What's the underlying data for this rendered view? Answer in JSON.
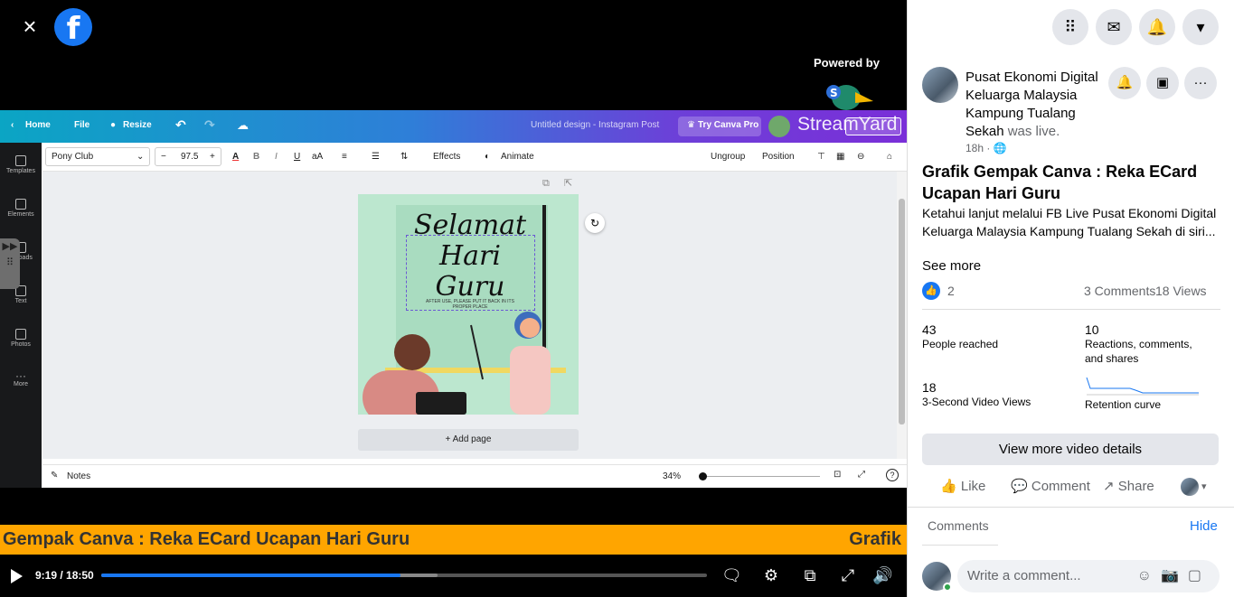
{
  "viewer": {
    "close_label": "×",
    "powered_by": "Powered by",
    "streamyard": "StreamYard"
  },
  "canva": {
    "home": "Home",
    "file": "File",
    "resize": "Resize",
    "doc_title": "Untitled design - Instagram Post",
    "try_pro": "Try Canva Pro",
    "font_name": "Pony Club",
    "font_size": "97.5",
    "effects": "Effects",
    "animate": "Animate",
    "ungroup": "Ungroup",
    "position": "Position",
    "sidebar": [
      "Templates",
      "Elements",
      "Uploads",
      "Text",
      "Photos",
      "More"
    ],
    "design_text_1": "Selamat Hari",
    "design_text_2": "Guru",
    "design_small": "AFTER USE, PLEASE PUT IT BACK IN ITS PROPER PLACE",
    "add_page": "+ Add page",
    "notes": "Notes",
    "zoom": "34%"
  },
  "ticker": {
    "left_text": "Gempak Canva : Reka ECard Ucapan Hari Guru",
    "right_text": "Grafik"
  },
  "player": {
    "time": "9:19 / 18:50",
    "progress_fraction": 0.494,
    "buffered_fraction": 0.555
  },
  "post": {
    "page_name": "Pusat Ekonomi Digital Keluarga Malaysia Kampung Tualang Sekah",
    "was_live": "was live.",
    "timestamp": "18h ·",
    "title": "Grafik Gempak Canva : Reka ECard Ucapan Hari Guru",
    "description": "Ketahui lanjut melalui FB Live Pusat Ekonomi Digital Keluarga Malaysia Kampung Tualang Sekah di siri...",
    "see_more": "See more",
    "reaction_count": "2",
    "comments_count": "3 Comments",
    "views_count": "18 Views",
    "stats": [
      {
        "number": "43",
        "label": "People reached"
      },
      {
        "number": "10",
        "label": "Reactions, comments, and shares"
      },
      {
        "number": "18",
        "label": "3-Second Video Views"
      },
      {
        "number": "",
        "label": "Retention curve"
      }
    ],
    "view_more_details": "View more video details",
    "like": "Like",
    "comment": "Comment",
    "share": "Share",
    "comments_heading": "Comments",
    "hide": "Hide",
    "comment_placeholder": "Write a comment..."
  },
  "colors": {
    "facebook_blue": "#1877f2",
    "ticker_orange": "#ffa500",
    "canva_gradient_start": "#0ba5c4",
    "canva_gradient_end": "#7a2fd8",
    "design_bg": "#bce7cf"
  }
}
